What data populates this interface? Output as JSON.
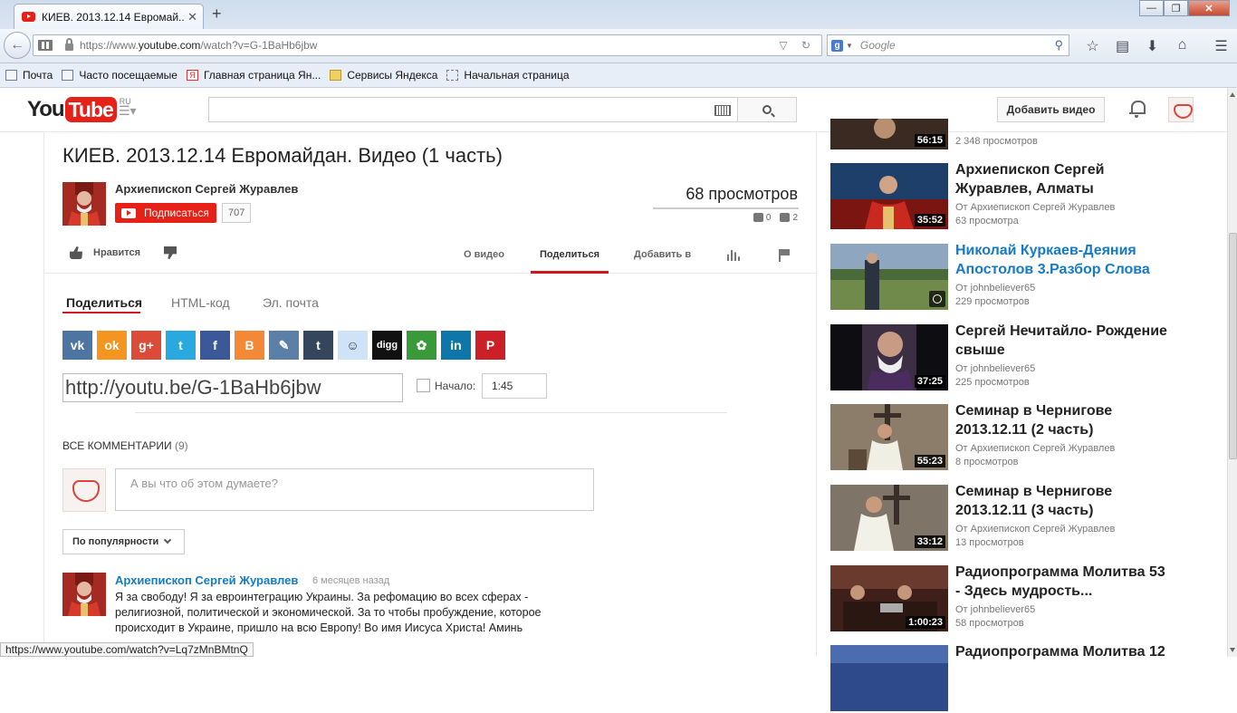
{
  "browser": {
    "tab_title": "КИЕВ. 2013.12.14 Евромай...",
    "url_prefix": "https://www.",
    "url_domain": "youtube.com",
    "url_path": "/watch?v=G-1BaHb6jbw",
    "search_placeholder": "Google",
    "bookmarks": [
      "Почта",
      "Часто посещаемые",
      "Главная страница Ян...",
      "Сервисы Яндекса",
      "Начальная страница"
    ]
  },
  "masthead": {
    "logo_you": "You",
    "logo_tube": "Tube",
    "region": "RU",
    "upload_label": "Добавить видео"
  },
  "video": {
    "title": "КИЕВ. 2013.12.14 Евромайдан. Видео (1 часть)",
    "owner": "Архиепископ Сергей Журавлев",
    "subscribe_label": "Подписаться",
    "subscriber_count": "707",
    "views": "68 просмотров",
    "likes": "0",
    "dislikes": "2",
    "like_label": "Нравится",
    "tabs": [
      "О видео",
      "Поделиться",
      "Добавить в"
    ]
  },
  "share": {
    "tabs": [
      "Поделиться",
      "HTML-код",
      "Эл. почта"
    ],
    "short_url": "http://youtu.be/G-1BaHb6jbw",
    "start_label": "Начало:",
    "start_time": "1:45",
    "networks": [
      {
        "name": "vk",
        "glyph": "vk",
        "color": "#4c75a3"
      },
      {
        "name": "odnoklassniki",
        "glyph": "ok",
        "color": "#f4951f"
      },
      {
        "name": "google-plus",
        "glyph": "g+",
        "color": "#dc4a38"
      },
      {
        "name": "twitter",
        "glyph": "t",
        "color": "#2aa9e0"
      },
      {
        "name": "facebook",
        "glyph": "f",
        "color": "#3b5998"
      },
      {
        "name": "blogger",
        "glyph": "B",
        "color": "#f38936"
      },
      {
        "name": "livejournal",
        "glyph": "✎",
        "color": "#5b7fa6"
      },
      {
        "name": "tumblr",
        "glyph": "t",
        "color": "#35465c"
      },
      {
        "name": "reddit",
        "glyph": "☺",
        "color": "#cee3f8"
      },
      {
        "name": "digg",
        "glyph": "digg",
        "color": "#111111"
      },
      {
        "name": "mixi",
        "glyph": "✿",
        "color": "#3a9a3a"
      },
      {
        "name": "linkedin",
        "glyph": "in",
        "color": "#0e76a8"
      },
      {
        "name": "pinterest",
        "glyph": "P",
        "color": "#cb2027"
      }
    ]
  },
  "comments": {
    "title": "Все комментарии",
    "count": "(9)",
    "placeholder": "А вы что об этом думаете?",
    "sort_label": "По популярности",
    "items": [
      {
        "author": "Архиепископ Сергей Журавлев",
        "time": "6 месяцев назад",
        "text": "Я за свободу! Я за евроинтеграцию Украины. За рефомацию во всех сферах - религиозной, политической и экономической. За то чтобы пробуждение, которое происходит в Украине, пришло на всю Европу! Во имя Иисуса Христа! Аминь"
      }
    ]
  },
  "related": [
    {
      "title": "",
      "by": "",
      "views": "2 348 просмотров",
      "duration": "56:15"
    },
    {
      "title": "Архиепископ Сергей Журавлев, Алматы",
      "by": "От Архиепископ Сергей Журавлев",
      "views": "63 просмотра",
      "duration": "35:52"
    },
    {
      "title": "Николай Куркаев-Деяния Апостолов 3.Разбор Слова",
      "by": "От johnbeliever65",
      "views": "229 просмотров",
      "duration": ""
    },
    {
      "title": "Сергей Нечитайло- Рождение свыше",
      "by": "От johnbeliever65",
      "views": "225 просмотров",
      "duration": "37:25"
    },
    {
      "title": "Семинар в Чернигове 2013.12.11 (2 часть)",
      "by": "От Архиепископ Сергей Журавлев",
      "views": "8 просмотров",
      "duration": "55:23"
    },
    {
      "title": "Семинар в Чернигове 2013.12.11 (3 часть)",
      "by": "От Архиепископ Сергей Журавлев",
      "views": "13 просмотров",
      "duration": "33:12"
    },
    {
      "title": "Радиопрограмма Молитва 53 - Здесь мудрость...",
      "by": "От johnbeliever65",
      "views": "58 просмотров",
      "duration": "1:00:23"
    },
    {
      "title": "Радиопрограмма Молитва 12",
      "by": "",
      "views": "",
      "duration": ""
    }
  ],
  "status_url": "https://www.youtube.com/watch?v=Lq7zMnBMtnQ"
}
